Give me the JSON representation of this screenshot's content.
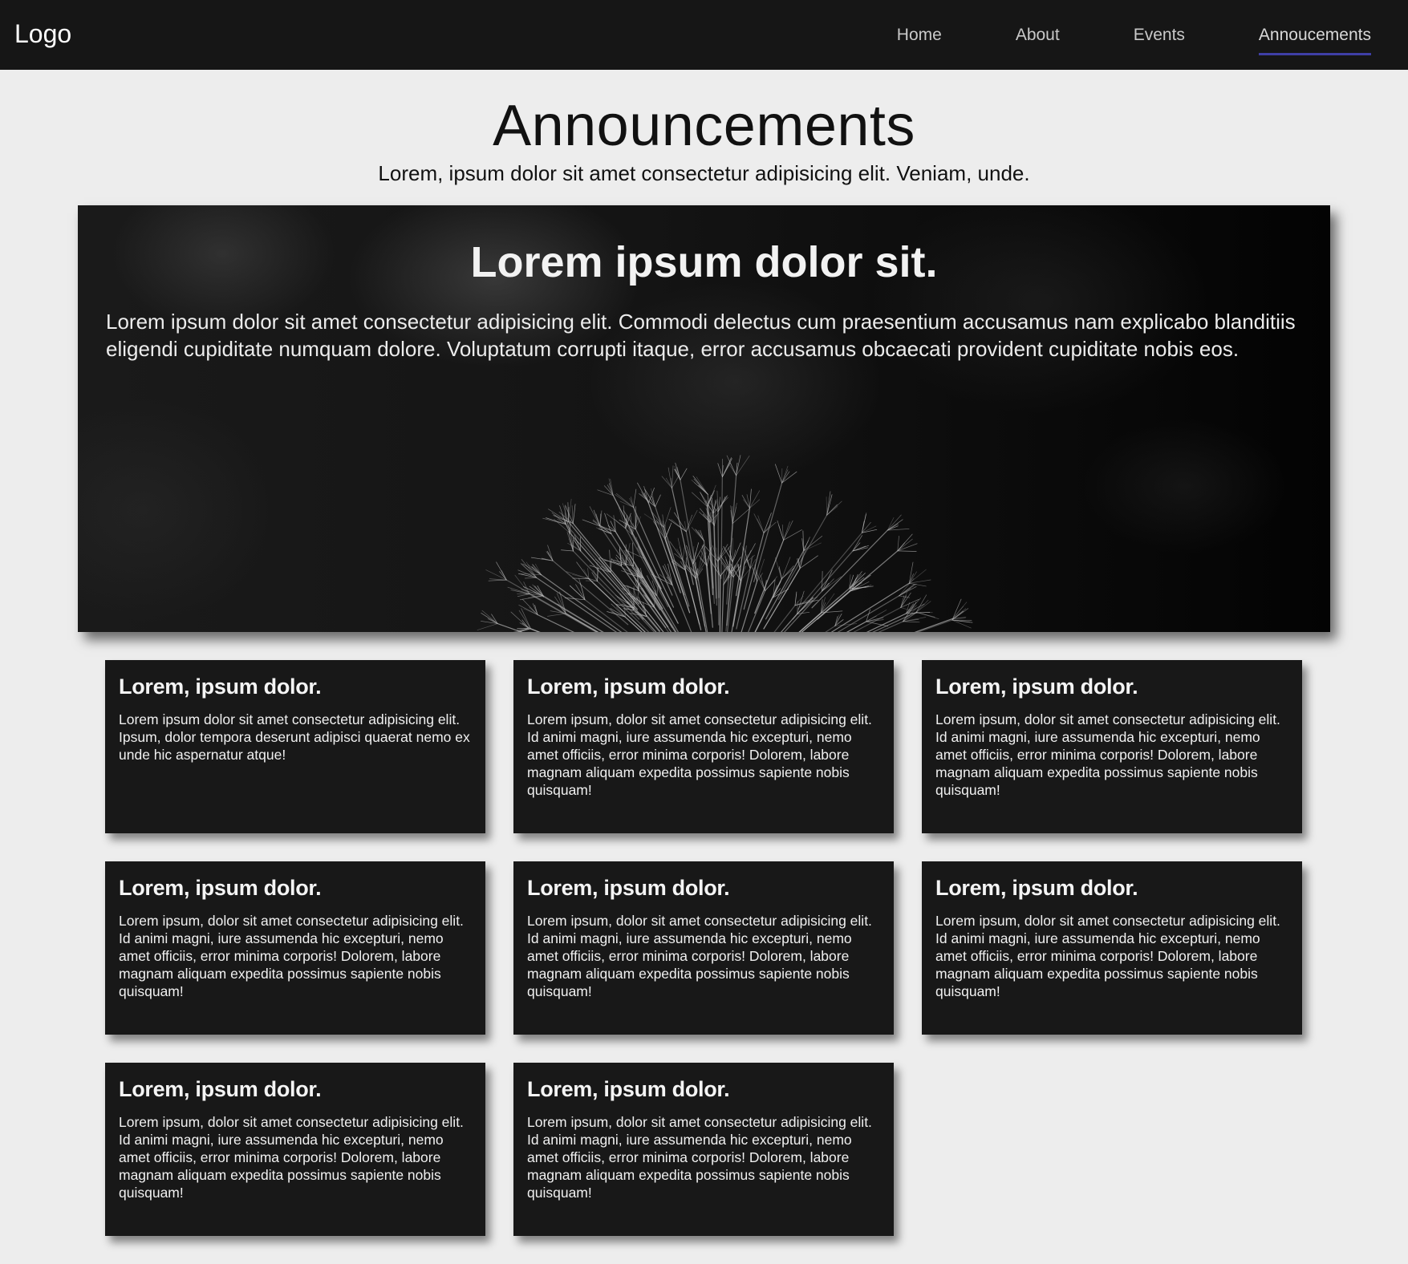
{
  "navbar": {
    "logo": "Logo",
    "links": [
      {
        "label": "Home",
        "active": false
      },
      {
        "label": "About",
        "active": false
      },
      {
        "label": "Events",
        "active": false
      },
      {
        "label": "Annoucements",
        "active": true
      }
    ],
    "active_underline_color": "#3f3fa6",
    "background_color": "#161616"
  },
  "header": {
    "title": "Announcements",
    "subtitle": "Lorem, ipsum dolor sit amet consectetur adipisicing elit. Veniam, unde."
  },
  "hero": {
    "title": "Lorem ipsum dolor sit.",
    "text": "Lorem ipsum dolor sit amet consectetur adipisicing elit. Commodi delectus cum praesentium accusamus nam explicabo blanditiis eligendi cupiditate numquam dolore. Voluptatum corrupti itaque, error accusamus obcaecati provident cupiditate nobis eos.",
    "image": "dandelion-photo"
  },
  "cards": [
    {
      "title": "Lorem, ipsum dolor.",
      "text": "Lorem ipsum dolor sit amet consectetur adipisicing elit. Ipsum, dolor tempora deserunt adipisci quaerat nemo ex unde hic aspernatur atque!"
    },
    {
      "title": "Lorem, ipsum dolor.",
      "text": "Lorem ipsum, dolor sit amet consectetur adipisicing elit. Id animi magni, iure assumenda hic excepturi, nemo amet officiis, error minima corporis! Dolorem, labore magnam aliquam expedita possimus sapiente nobis quisquam!"
    },
    {
      "title": "Lorem, ipsum dolor.",
      "text": "Lorem ipsum, dolor sit amet consectetur adipisicing elit. Id animi magni, iure assumenda hic excepturi, nemo amet officiis, error minima corporis! Dolorem, labore magnam aliquam expedita possimus sapiente nobis quisquam!"
    },
    {
      "title": "Lorem, ipsum dolor.",
      "text": "Lorem ipsum, dolor sit amet consectetur adipisicing elit. Id animi magni, iure assumenda hic excepturi, nemo amet officiis, error minima corporis! Dolorem, labore magnam aliquam expedita possimus sapiente nobis quisquam!"
    },
    {
      "title": "Lorem, ipsum dolor.",
      "text": "Lorem ipsum, dolor sit amet consectetur adipisicing elit. Id animi magni, iure assumenda hic excepturi, nemo amet officiis, error minima corporis! Dolorem, labore magnam aliquam expedita possimus sapiente nobis quisquam!"
    },
    {
      "title": "Lorem, ipsum dolor.",
      "text": "Lorem ipsum, dolor sit amet consectetur adipisicing elit. Id animi magni, iure assumenda hic excepturi, nemo amet officiis, error minima corporis! Dolorem, labore magnam aliquam expedita possimus sapiente nobis quisquam!"
    },
    {
      "title": "Lorem, ipsum dolor.",
      "text": "Lorem ipsum, dolor sit amet consectetur adipisicing elit. Id animi magni, iure assumenda hic excepturi, nemo amet officiis, error minima corporis! Dolorem, labore magnam aliquam expedita possimus sapiente nobis quisquam!"
    },
    {
      "title": "Lorem, ipsum dolor.",
      "text": "Lorem ipsum, dolor sit amet consectetur adipisicing elit. Id animi magni, iure assumenda hic excepturi, nemo amet officiis, error minima corporis! Dolorem, labore magnam aliquam expedita possimus sapiente nobis quisquam!"
    }
  ]
}
